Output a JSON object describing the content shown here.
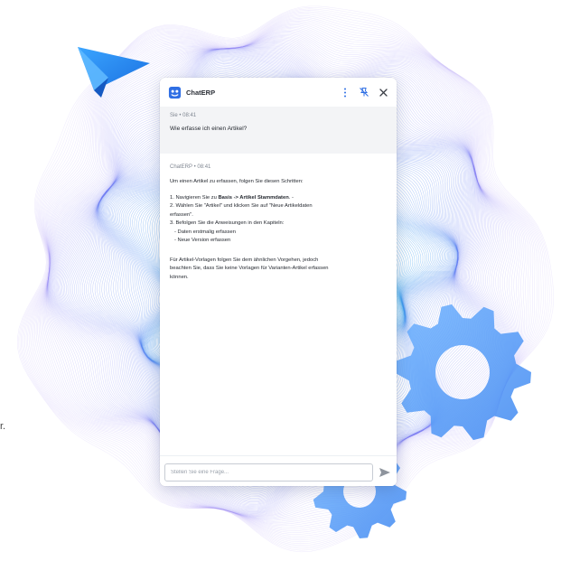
{
  "page": {
    "stray_text": "r."
  },
  "chat": {
    "app_title": "ChatERP",
    "icons": {
      "logo": "chaterp-logo-icon",
      "more": "more-vertical-icon",
      "unpin": "pin-off-icon",
      "close": "close-icon",
      "send": "send-icon"
    },
    "colors": {
      "accent": "#2f6fe4",
      "muted": "#7f8691",
      "user_bg": "#f3f4f6"
    },
    "user_message": {
      "author": "Sie",
      "separator": "•",
      "time": "08:41",
      "text": "Wie erfasse ich einen Artikel?"
    },
    "bot_message": {
      "author": "ChatERP",
      "separator": "•",
      "time": "08:41",
      "intro": "Um einen Artikel zu erfassen, folgen Sie diesen Schritten:",
      "step1_prefix": "1. Navigieren Sie zu ",
      "step1_path": "Basis -> Artikel Stammdaten",
      "step1_suffix": ". -",
      "step2_line1": "2. Wählen Sie \"Artikel\" und klicken Sie auf \"Neue Artikeldaten",
      "step2_line2": "erfassen\".",
      "step3": "3. Befolgen Sie die Anweisungen in den Kapiteln:",
      "step3_item1": "- Daten erstmalig erfassen",
      "step3_item2": "- Neue Version erfassen",
      "note_line1": "Für Artikel-Vorlagen folgen Sie dem ähnlichen Vorgehen, jedoch",
      "note_line2": "beachten Sie, dass Sie keine Vorlagen für Varianten-Artikel erfassen",
      "note_line3": "können."
    },
    "composer": {
      "placeholder": "Stellen Sie eine Frage...",
      "value": ""
    }
  }
}
